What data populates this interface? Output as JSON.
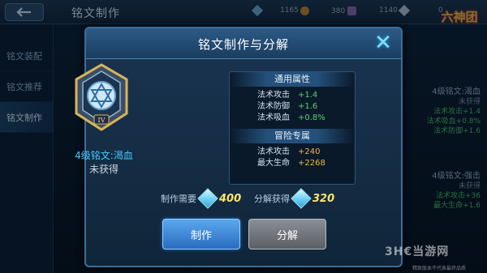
{
  "header": {
    "back_icon": "back-arrow-icon",
    "title": "铭文制作",
    "resources": [
      {
        "icon": "gem-icon",
        "value": "1165"
      },
      {
        "icon": "coin-icon",
        "value": "380"
      },
      {
        "icon": "token-icon",
        "value": "1140"
      },
      {
        "icon": "diamond-icon",
        "value": "0"
      }
    ],
    "logo_text": "六神团"
  },
  "sidebar": {
    "items": [
      {
        "label": "铭文装配"
      },
      {
        "label": "铭文推荐"
      },
      {
        "label": "铭文制作"
      }
    ]
  },
  "right_list": [
    {
      "title": "4级铭文:渴血",
      "status": "未获得",
      "stats": [
        "法术攻击+1.4",
        "法术吸血+0.8%",
        "法术防御+1.6"
      ]
    },
    {
      "title": "4级铭文:强击",
      "status": "未获得",
      "stats": [
        "法术攻击+36",
        "最大生命+1.6"
      ]
    }
  ],
  "dialog": {
    "title": "铭文制作与分解",
    "close_icon": "close-icon",
    "rune": {
      "level_numeral": "IV",
      "name": "4级铭文:渴血",
      "status": "未获得"
    },
    "general": {
      "title": "通用属性",
      "rows": [
        {
          "label": "法术攻击",
          "value": "+1.4"
        },
        {
          "label": "法术防御",
          "value": "+1.6"
        },
        {
          "label": "法术吸血",
          "value": "+0.8%"
        }
      ]
    },
    "adventure": {
      "title": "冒险专属",
      "rows": [
        {
          "label": "法术攻击",
          "value": "+240"
        },
        {
          "label": "最大生命",
          "value": "+2268"
        }
      ]
    },
    "cost": {
      "label": "制作需要",
      "icon": "crystal-icon",
      "value": "400"
    },
    "gain": {
      "label": "分解获得",
      "icon": "crystal-icon",
      "value": "320"
    },
    "buttons": {
      "make": "制作",
      "split": "分解"
    }
  },
  "watermark": {
    "brand": "3H€当游网",
    "sub": "精致版本不代表最终品质"
  },
  "colors": {
    "accent": "#2a6cc0",
    "stat_green": "#5ccf6e",
    "stat_orange": "#f0b64a",
    "rune_name": "#46c8ff",
    "cost_number": "#ffe46a"
  }
}
